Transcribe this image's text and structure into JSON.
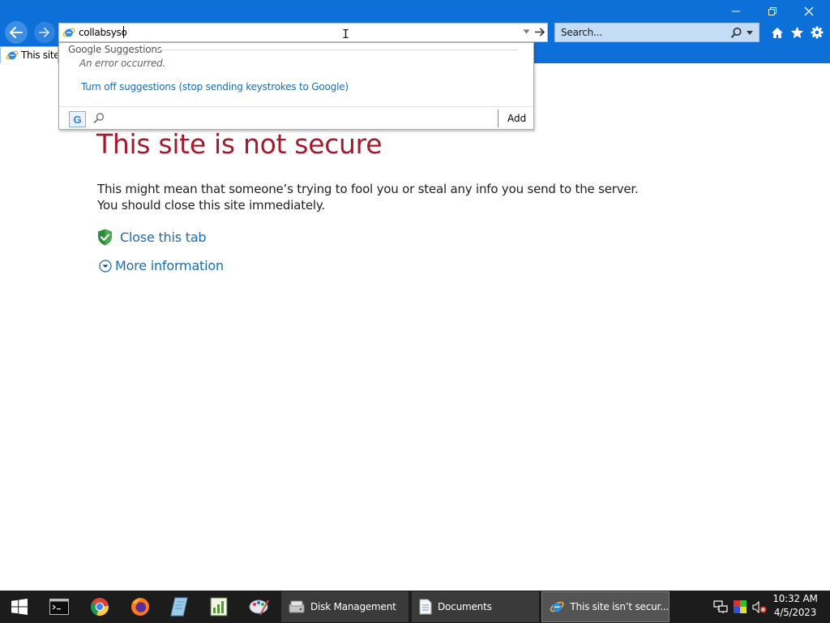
{
  "browser": {
    "address_value": "collabsyso",
    "search_placeholder": "Search...",
    "tab_label": "This site is not secure"
  },
  "suggestions": {
    "header": "Google Suggestions",
    "error": "An error occurred.",
    "turn_off": "Turn off suggestions (stop sending keystrokes to Google)",
    "provider_letter": "G",
    "add_label": "Add"
  },
  "page": {
    "title": "This site is not secure",
    "description": "This might mean that someone’s trying to fool you or steal any info you send to the server. You should close this site immediately.",
    "close_tab": "Close this tab",
    "more_info": "More information"
  },
  "taskbar": {
    "tasks": [
      {
        "label": "Disk Management"
      },
      {
        "label": "Documents"
      },
      {
        "label": "This site isn’t secur..."
      }
    ],
    "clock": {
      "time": "10:32 AM",
      "date": "4/5/2023"
    }
  },
  "colors": {
    "chrome_blue": "#0d6fd8",
    "title_red": "#a5192d",
    "link_blue": "#1a6db6",
    "taskbar": "#1c1c1c"
  },
  "icons": [
    "back-arrow-icon",
    "forward-arrow-icon",
    "ie-logo-icon",
    "dropdown-arrow-icon",
    "go-arrow-icon",
    "search-magnifier-icon",
    "home-icon",
    "favorites-star-icon",
    "tools-gear-icon",
    "shield-check-icon",
    "expand-chevron-icon",
    "windows-logo-icon"
  ]
}
